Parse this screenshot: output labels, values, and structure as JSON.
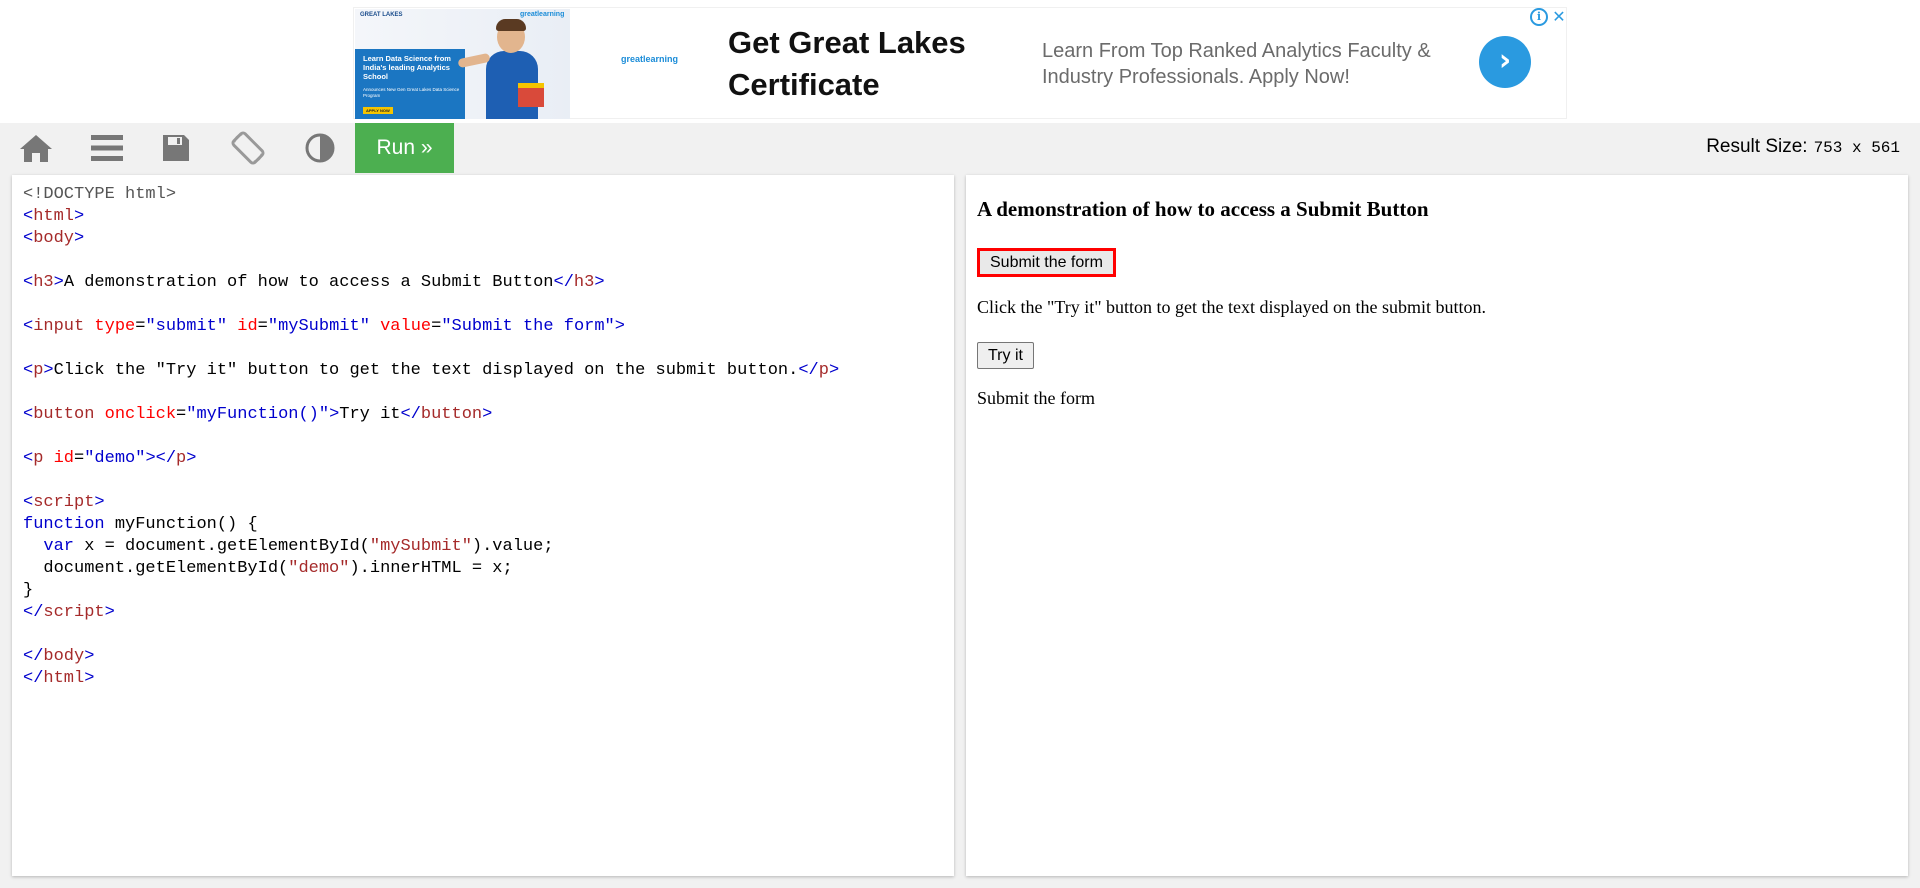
{
  "ad": {
    "image": {
      "logo_text": "GREAT LAKES",
      "brand_tag": "greatlearning",
      "headline": "Learn Data Science from India's leading Analytics School",
      "subtext": "Announces New Gen Great Lakes Data Science Program",
      "apply": "APPLY NOW"
    },
    "mid_logo": "greatlearning",
    "title": "Get Great Lakes Certificate",
    "description": "Learn From Top Ranked Analytics Faculty & Industry Professionals. Apply Now!",
    "arrow": "›",
    "info": "i",
    "close": "✕"
  },
  "toolbar": {
    "icons": [
      "home-icon",
      "menu-icon",
      "save-icon",
      "rotate-icon",
      "theme-toggle-icon"
    ],
    "run_label": "Run »",
    "result_size_label": "Result Size:",
    "result_size_value": "753 x 561"
  },
  "result": {
    "heading": "A demonstration of how to access a Submit Button",
    "submit_label": "Submit the form",
    "paragraph": "Click the \"Try it\" button to get the text displayed on the submit button.",
    "try_label": "Try it",
    "demo_text": "Submit the form"
  },
  "colors": {
    "run_green": "#4caf50",
    "tag_brown": "#a52a2a",
    "bracket_blue": "#0000cd",
    "attr_red": "#ff0000",
    "highlight_red": "#ff0000",
    "ad_blue": "#2a9ae0"
  }
}
